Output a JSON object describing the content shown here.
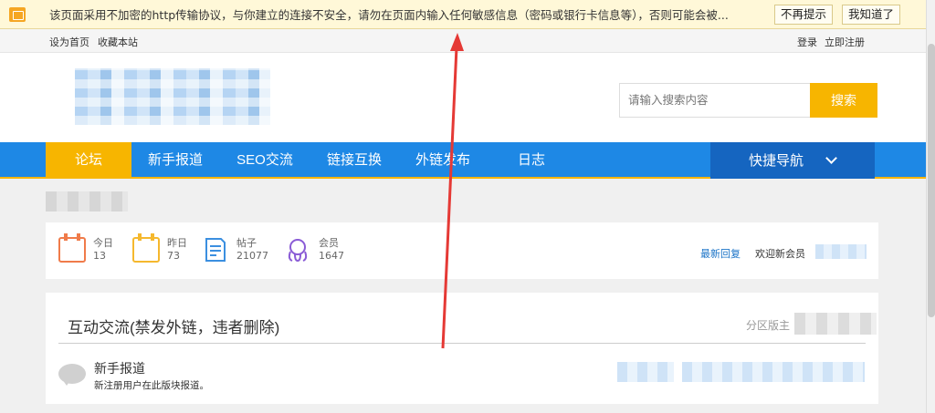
{
  "warning": {
    "text": "该页面采用不加密的http传输协议，与你建立的连接不安全，请勿在页面内输入任何敏感信息（密码或银行卡信息等），否则可能会被...",
    "dismiss_label": "不再提示",
    "ok_label": "我知道了"
  },
  "toplinks": {
    "home": "设为首页",
    "bookmark": "收藏本站",
    "login": "登录",
    "register": "立即注册"
  },
  "search": {
    "placeholder": "请输入搜索内容",
    "button": "搜索"
  },
  "nav": {
    "items": [
      "论坛",
      "新手报道",
      "SEO交流",
      "链接互换",
      "外链发布",
      "日志"
    ],
    "quick": "快捷导航"
  },
  "stats": {
    "today": {
      "label": "今日",
      "value": "13"
    },
    "yesterday": {
      "label": "昨日",
      "value": "73"
    },
    "posts": {
      "label": "帖子",
      "value": "21077"
    },
    "members": {
      "label": "会员",
      "value": "1647"
    },
    "latest_reply": "最新回复",
    "welcome": "欢迎新会员"
  },
  "forum": {
    "title": "互动交流(禁发外链，违者删除)",
    "moderators": "分区版主",
    "board_name": "新手报道",
    "board_desc": "新注册用户在此版块报道。"
  },
  "colors": {
    "accent": "#f7b500",
    "nav": "#1e88e5",
    "nav_dark": "#1565c0",
    "annotation": "#e53935"
  }
}
